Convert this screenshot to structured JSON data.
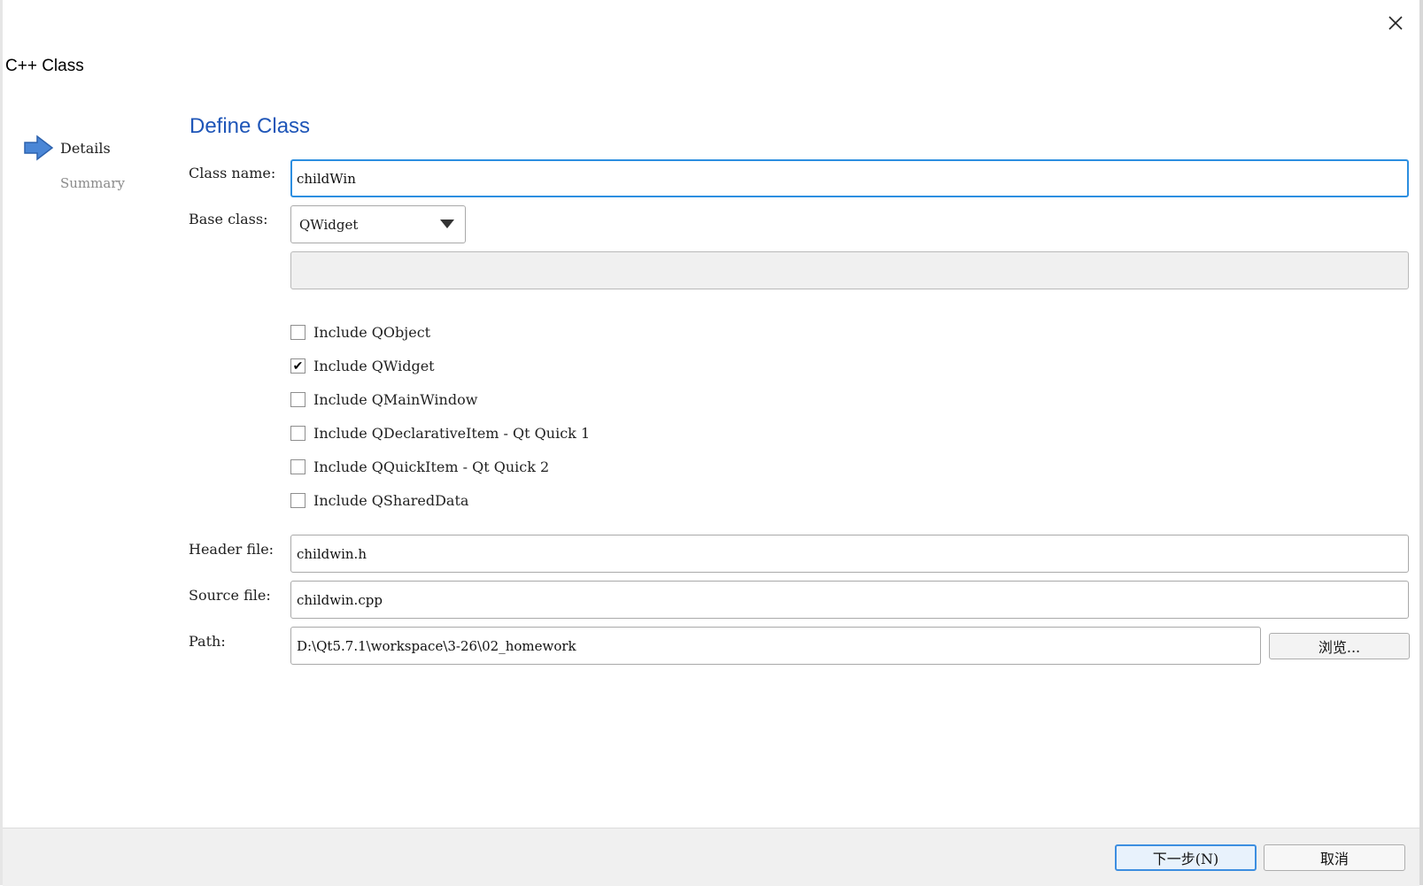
{
  "window": {
    "title": "C++ Class"
  },
  "nav": {
    "items": [
      {
        "label": "Details"
      },
      {
        "label": "Summary"
      }
    ]
  },
  "page": {
    "heading": "Define Class"
  },
  "form": {
    "class_name_label": "Class name:",
    "class_name_value": "childWin",
    "base_class_label": "Base class:",
    "base_class_value": "QWidget",
    "checkboxes": [
      {
        "label": "Include QObject",
        "checked": false
      },
      {
        "label": "Include QWidget",
        "checked": true
      },
      {
        "label": "Include QMainWindow",
        "checked": false
      },
      {
        "label": "Include QDeclarativeItem - Qt Quick 1",
        "checked": false
      },
      {
        "label": "Include QQuickItem - Qt Quick 2",
        "checked": false
      },
      {
        "label": "Include QSharedData",
        "checked": false
      }
    ],
    "header_label": "Header file:",
    "header_value": "childwin.h",
    "source_label": "Source file:",
    "source_value": "childwin.cpp",
    "path_label": "Path:",
    "path_value": "D:\\Qt5.7.1\\workspace\\3-26\\02_homework",
    "browse_label": "浏览..."
  },
  "footer": {
    "next_label": "下一步(N)",
    "cancel_label": "取消"
  },
  "colors": {
    "accent": "#1f56b8",
    "focus": "#2c8ee0",
    "nav_arrow": "#4a86d6"
  },
  "icons": {
    "close": "close-icon",
    "nav_current": "arrow-right-icon",
    "checkmark": "check-icon"
  }
}
